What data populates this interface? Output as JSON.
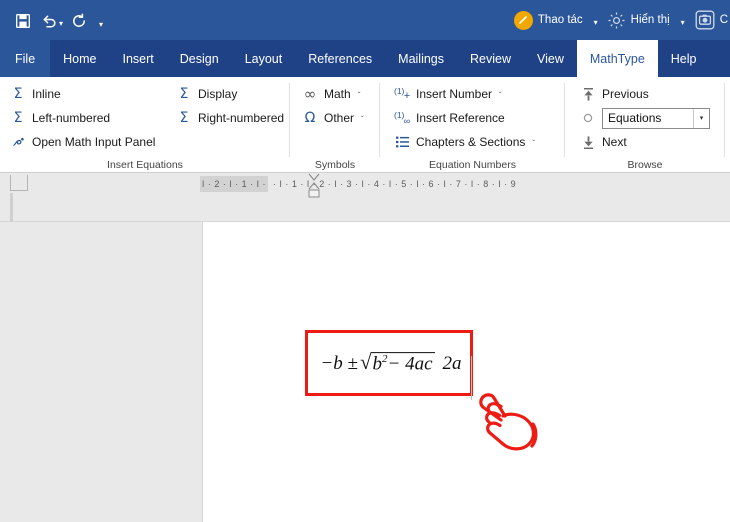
{
  "titlebar": {
    "quick_access": [
      {
        "name": "save",
        "icon": "save-icon"
      },
      {
        "name": "undo",
        "icon": "undo-icon",
        "has_dropdown": true
      },
      {
        "name": "redo",
        "icon": "redo-icon"
      },
      {
        "name": "customize",
        "icon": "chevron-down-icon"
      }
    ],
    "right_items": [
      {
        "label": "Thao tác",
        "icon": "pen-icon",
        "caret": "▾"
      },
      {
        "label": "Hiển thị",
        "icon": "gear-icon",
        "caret": "▾"
      },
      {
        "label": "C",
        "icon": "camera-icon",
        "caret": ""
      }
    ],
    "background": "#2b579a",
    "accent": "#f2a800"
  },
  "tabs": [
    {
      "label": "File",
      "active": false,
      "is_file": true
    },
    {
      "label": "Home",
      "active": false
    },
    {
      "label": "Insert",
      "active": false
    },
    {
      "label": "Design",
      "active": false
    },
    {
      "label": "Layout",
      "active": false
    },
    {
      "label": "References",
      "active": false
    },
    {
      "label": "Mailings",
      "active": false
    },
    {
      "label": "Review",
      "active": false
    },
    {
      "label": "View",
      "active": false
    },
    {
      "label": "MathType",
      "active": true
    },
    {
      "label": "Help",
      "active": false
    }
  ],
  "ribbon": {
    "groups": [
      {
        "label": "Insert Equations",
        "items": [
          {
            "label": "Inline",
            "icon": "sigma-inline-icon"
          },
          {
            "label": "Display",
            "icon": "sigma-display-icon"
          },
          {
            "label": "Left-numbered",
            "icon": "sigma-left-numbered-icon"
          },
          {
            "label": "Right-numbered",
            "icon": "sigma-right-numbered-icon"
          },
          {
            "label": "Open Math Input Panel",
            "icon": "math-input-panel-icon"
          }
        ]
      },
      {
        "label": "Symbols",
        "items": [
          {
            "label": "Math",
            "icon": "infinity-icon",
            "caret": "ˇ"
          },
          {
            "label": "Other",
            "icon": "omega-icon",
            "caret": "ˇ"
          }
        ]
      },
      {
        "label": "Equation Numbers",
        "items": [
          {
            "label": "Insert Number",
            "icon": "insert-number-icon",
            "caret": "ˇ"
          },
          {
            "label": "Insert Reference",
            "icon": "insert-reference-icon",
            "caret": ""
          },
          {
            "label": "Chapters & Sections",
            "icon": "chapters-sections-icon",
            "caret": "ˇ"
          }
        ]
      },
      {
        "label": "Browse",
        "items": [
          {
            "label": "Previous",
            "icon": "arrow-up-icon"
          },
          {
            "label": "Next",
            "icon": "arrow-down-icon"
          }
        ],
        "combo": {
          "label": "Equations",
          "icon": "circle-icon",
          "caret": "▾"
        }
      }
    ]
  },
  "ruler": {
    "margin_marks": "ǀ  ·  2  ·  ǀ  ·  1  ·  ǀ  · ",
    "body_marks": "·  ǀ  ·  1  ·  ǀ  ·  2  ·  ǀ  ·  3  ·  ǀ  ·  4  ·  ǀ  ·  5  ·  ǀ  ·  6  ·  ǀ  ·  7  ·  ǀ  ·  8  ·  ǀ  ·  9"
  },
  "document": {
    "equation": {
      "numerator_lead": "−b ±",
      "radicand_base": "b",
      "radicand_exp": "2",
      "radicand_tail": "− 4ac",
      "denominator": "2a",
      "highlight_color": "#ee1b14"
    },
    "pointer": {
      "icon": "pointing-hand-icon",
      "color": "#ee1b14"
    }
  }
}
